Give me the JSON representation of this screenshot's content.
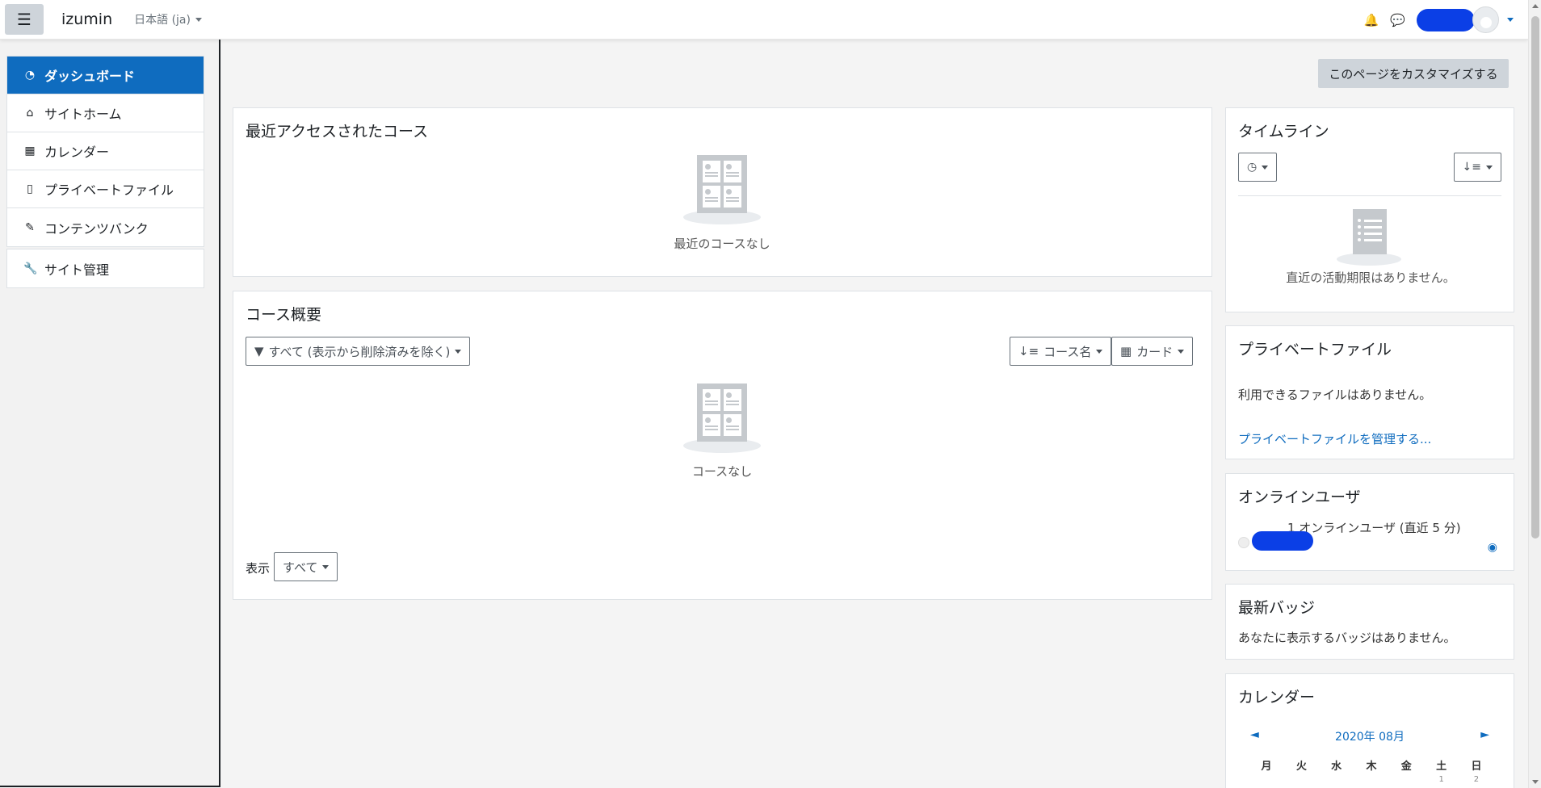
{
  "navbar": {
    "brand": "izumin",
    "language": "日本語 (ja)",
    "menu_icon": "☰",
    "bell_icon": "🔔",
    "chat_icon": "💬"
  },
  "sidebar": {
    "items": [
      {
        "label": "ダッシュボード",
        "icon": "tachometer-icon",
        "glyph": "◔",
        "active": true
      },
      {
        "label": "サイトホーム",
        "icon": "home-icon",
        "glyph": "⌂"
      },
      {
        "label": "カレンダー",
        "icon": "calendar-icon",
        "glyph": "▦"
      },
      {
        "label": "プライベートファイル",
        "icon": "file-icon",
        "glyph": "▯"
      },
      {
        "label": "コンテンツバンク",
        "icon": "paint-brush-icon",
        "glyph": "✎"
      }
    ],
    "admin": {
      "label": "サイト管理",
      "icon": "wrench-icon",
      "glyph": "🔧"
    }
  },
  "main": {
    "customize_label": "このページをカスタマイズする",
    "recent": {
      "title": "最近アクセスされたコース",
      "empty": "最近のコースなし"
    },
    "overview": {
      "title": "コース概要",
      "filter_label": "すべて (表示から削除済みを除く)",
      "sort_label": "コース名",
      "view_label": "カード",
      "empty": "コースなし",
      "show_label": "表示",
      "show_value": "すべて"
    }
  },
  "blocks": {
    "timeline": {
      "title": "タイムライン",
      "empty": "直近の活動期限はありません。"
    },
    "private_files": {
      "title": "プライベートファイル",
      "empty": "利用できるファイルはありません。",
      "manage_link": "プライベートファイルを管理する..."
    },
    "online_users": {
      "title": "オンラインユーザ",
      "summary": "1 オンラインユーザ (直近 5 分)"
    },
    "badges": {
      "title": "最新バッジ",
      "empty": "あなたに表示するバッジはありません。"
    },
    "calendar": {
      "title": "カレンダー",
      "prev": "◄",
      "month": "2020年 08月",
      "next": "►",
      "weekdays": [
        "月",
        "火",
        "水",
        "木",
        "金",
        "土",
        "日"
      ],
      "first_row": [
        "",
        "",
        "",
        "",
        "",
        "1",
        "2"
      ]
    }
  },
  "colors": {
    "primary": "#0f6cbf",
    "redaction": "#0b3fe6"
  }
}
